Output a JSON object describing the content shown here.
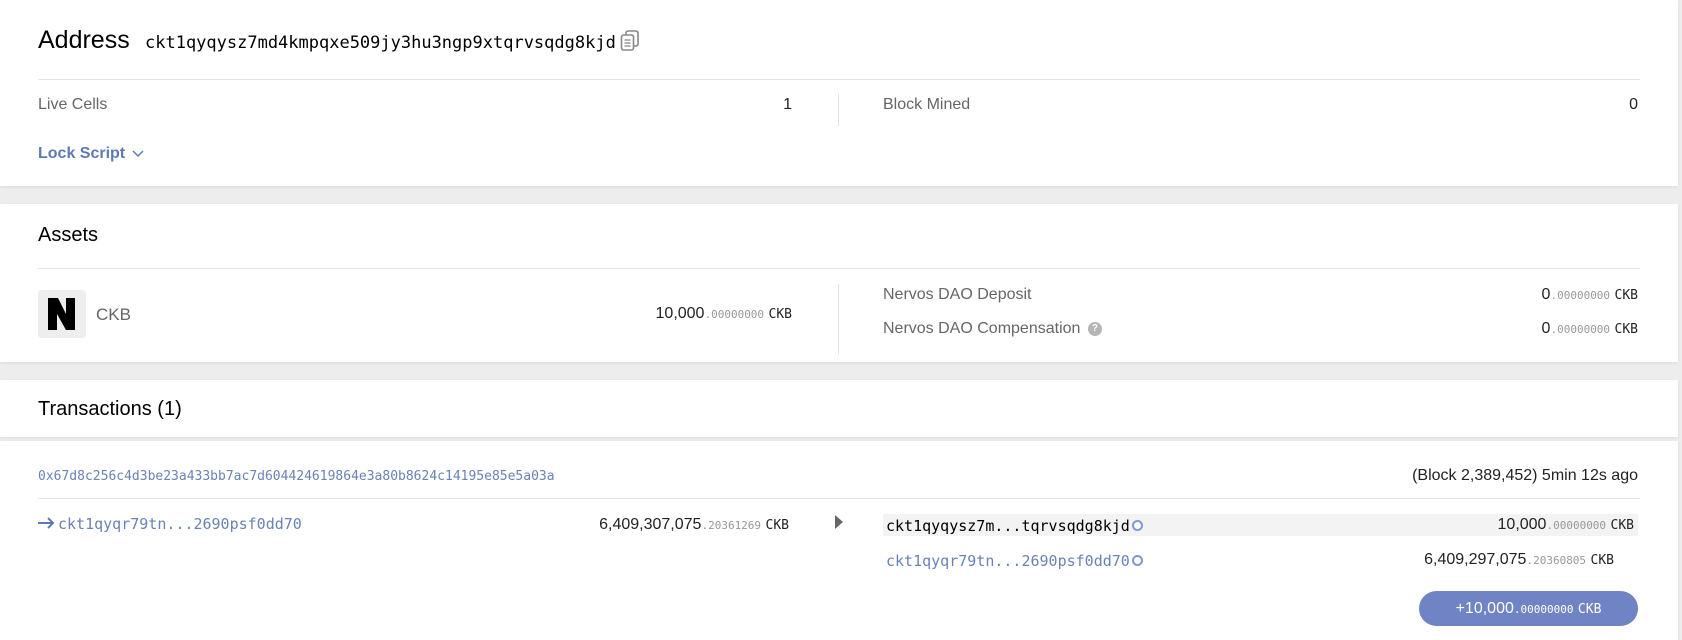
{
  "address": {
    "title": "Address",
    "hash": "ckt1qyqysz7md4kmpqxe509jy3hu3ngp9xtqrvsqdg8kjd",
    "live_cells_label": "Live Cells",
    "live_cells_value": "1",
    "block_mined_label": "Block Mined",
    "block_mined_value": "0",
    "lock_script_label": "Lock Script"
  },
  "assets": {
    "title": "Assets",
    "token_name": "CKB",
    "ckb_int": "10,000",
    "ckb_dec": ".00000000",
    "ckb_unit": "CKB",
    "dao_deposit_label": "Nervos DAO Deposit",
    "dao_deposit_int": "0",
    "dao_deposit_dec": ".00000000",
    "dao_deposit_unit": "CKB",
    "dao_comp_label": "Nervos DAO Compensation",
    "dao_comp_int": "0",
    "dao_comp_dec": ".00000000",
    "dao_comp_unit": "CKB"
  },
  "transactions": {
    "title": "Transactions (1)",
    "items": [
      {
        "hash": "0x67d8c256c4d3be23a433bb7ac7d604424619864e3a80b8624c14195e85e5a03a",
        "block_info": "(Block 2,389,452) 5min 12s ago",
        "input": {
          "address": "ckt1qyqr79tn...2690psf0dd70",
          "amount_int": "6,409,307,075",
          "amount_dec": ".20361269",
          "unit": "CKB"
        },
        "outputs": [
          {
            "address": "ckt1qyqysz7m...tqrvsqdg8kjd",
            "amount_int": "10,000",
            "amount_dec": ".00000000",
            "unit": "CKB"
          },
          {
            "address": "ckt1qyqr79tn...2690psf0dd70",
            "amount_int": "6,409,297,075",
            "amount_dec": ".20360805",
            "unit": "CKB"
          }
        ],
        "change_int": "+10,000",
        "change_dec": ".00000000",
        "change_unit": "CKB"
      }
    ]
  },
  "colors": {
    "accent": "#6f83c5",
    "link": "#6a82b8",
    "background": "#ededed"
  }
}
